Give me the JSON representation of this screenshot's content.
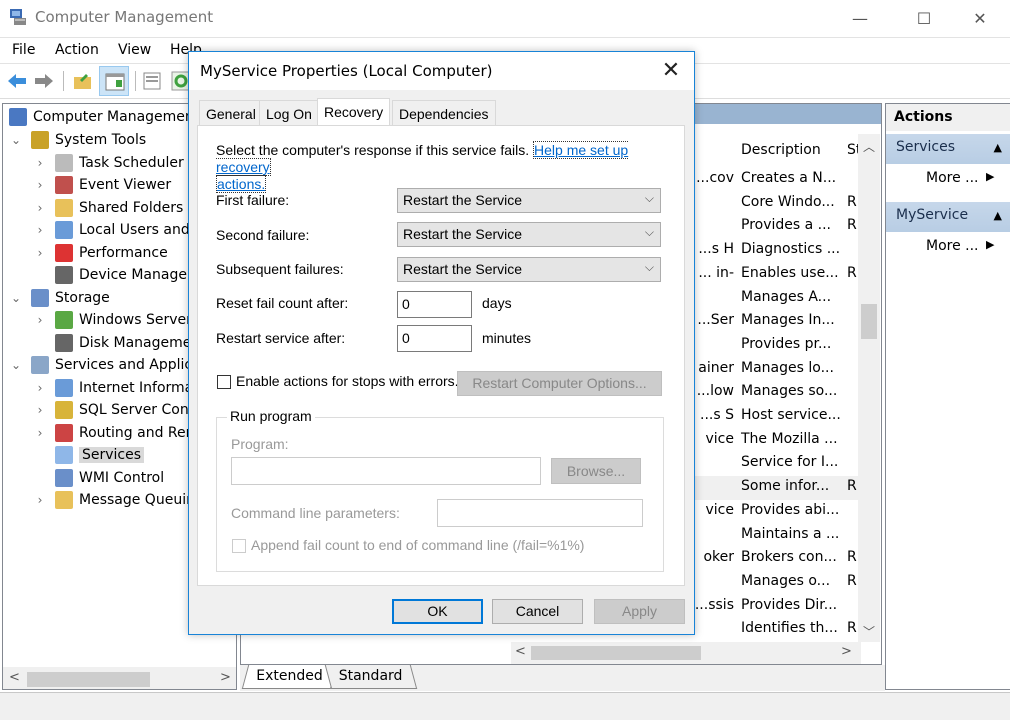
{
  "window": {
    "title": "Computer Management",
    "controls": {
      "minimize": "—",
      "maximize": "☐",
      "close": "✕"
    }
  },
  "menu": [
    "File",
    "Action",
    "View",
    "Help"
  ],
  "toolbar": {
    "icons": [
      "back-arrow-icon",
      "forward-arrow-icon",
      "up-folder-icon",
      "show-hide-console-tree-icon",
      "properties-icon",
      "refresh-icon"
    ]
  },
  "tree": {
    "root": "Computer Management",
    "items": [
      {
        "label": "System Tools",
        "level": 1,
        "expander": "⌄"
      },
      {
        "label": "Task Scheduler",
        "level": 2,
        "expander": "›"
      },
      {
        "label": "Event Viewer",
        "level": 2,
        "expander": "›"
      },
      {
        "label": "Shared Folders",
        "level": 2,
        "expander": "›"
      },
      {
        "label": "Local Users and Groups",
        "level": 2,
        "expander": "›"
      },
      {
        "label": "Performance",
        "level": 2,
        "expander": "›"
      },
      {
        "label": "Device Manager",
        "level": 2,
        "expander": ""
      },
      {
        "label": "Storage",
        "level": 1,
        "expander": "⌄"
      },
      {
        "label": "Windows Server Backup",
        "level": 2,
        "expander": "›"
      },
      {
        "label": "Disk Management",
        "level": 2,
        "expander": ""
      },
      {
        "label": "Services and Applications",
        "level": 1,
        "expander": "⌄"
      },
      {
        "label": "Internet Information Services",
        "level": 2,
        "expander": "›"
      },
      {
        "label": "SQL Server Configuration Manager",
        "level": 2,
        "expander": "›"
      },
      {
        "label": "Routing and Remote Access",
        "level": 2,
        "expander": "›"
      },
      {
        "label": "Services",
        "level": 2,
        "expander": "",
        "selected": true
      },
      {
        "label": "WMI Control",
        "level": 2,
        "expander": ""
      },
      {
        "label": "Message Queuing",
        "level": 2,
        "expander": "›"
      }
    ]
  },
  "services_list": {
    "columns": {
      "description": "Description",
      "status": "St"
    },
    "rows": [
      {
        "name_tail": "cov...",
        "description": "Creates a N...",
        "status": ""
      },
      {
        "name_tail": "",
        "description": "Core Windo...",
        "status": "R"
      },
      {
        "name_tail": "",
        "description": "Provides a ...",
        "status": "R"
      },
      {
        "name_tail": "s H...",
        "description": "Diagnostics ...",
        "status": ""
      },
      {
        "name_tail": "-in ...",
        "description": "Enables use...",
        "status": "R"
      },
      {
        "name_tail": "",
        "description": "Manages A...",
        "status": ""
      },
      {
        "name_tail": "Ser...",
        "description": "Manages In...",
        "status": ""
      },
      {
        "name_tail": "",
        "description": "Provides pr...",
        "status": ""
      },
      {
        "name_tail": "ainer",
        "description": "Manages lo...",
        "status": ""
      },
      {
        "name_tail": "low...",
        "description": "Manages so...",
        "status": ""
      },
      {
        "name_tail": "s S...",
        "description": "Host service...",
        "status": ""
      },
      {
        "name_tail": "vice",
        "description": "The Mozilla ...",
        "status": ""
      },
      {
        "name_tail": "",
        "description": "Service for I...",
        "status": ""
      },
      {
        "name_tail": "",
        "description": "Some infor...",
        "status": "R",
        "highlighted": true
      },
      {
        "name_tail": "vice",
        "description": "Provides abi...",
        "status": ""
      },
      {
        "name_tail": "",
        "description": "Maintains a ...",
        "status": ""
      },
      {
        "name_tail": "oker",
        "description": "Brokers con...",
        "status": "R"
      },
      {
        "name_tail": "",
        "description": "Manages o...",
        "status": "R"
      },
      {
        "name_tail": "ssis...",
        "description": "Provides Dir...",
        "status": ""
      },
      {
        "name_tail": "",
        "description": "Identifies th...",
        "status": "R"
      }
    ],
    "tabs": [
      "Extended",
      "Standard"
    ],
    "active_tab": "Extended"
  },
  "actions": {
    "title": "Actions",
    "sections": [
      {
        "header": "Services",
        "item": "More ..."
      },
      {
        "header": "MyService",
        "item": "More ..."
      }
    ]
  },
  "dialog": {
    "title": "MyService Properties (Local Computer)",
    "tabs": [
      "General",
      "Log On",
      "Recovery",
      "Dependencies"
    ],
    "active_tab": "Recovery",
    "intro": "Select the computer's response if this service fails.",
    "help_link_1": "Help me set up recovery",
    "help_link_2": "actions.",
    "first_failure_label": "First failure:",
    "first_failure_value": "Restart the Service",
    "second_failure_label": "Second failure:",
    "second_failure_value": "Restart the Service",
    "subsequent_label": "Subsequent failures:",
    "subsequent_value": "Restart the Service",
    "reset_label": "Reset fail count after:",
    "reset_value": "0",
    "reset_unit": "days",
    "restart_label": "Restart service after:",
    "restart_value": "0",
    "restart_unit": "minutes",
    "enable_actions_label": "Enable actions for stops with errors.",
    "enable_actions_checked": false,
    "restart_computer_options": "Restart Computer Options...",
    "run_program": {
      "title": "Run program",
      "program_label": "Program:",
      "program_value": "",
      "browse": "Browse...",
      "cmdline_label": "Command line parameters:",
      "cmdline_value": "",
      "append_label": "Append fail count to end of command line (/fail=%1%)",
      "append_checked": false
    },
    "buttons": {
      "ok": "OK",
      "cancel": "Cancel",
      "apply": "Apply"
    }
  }
}
